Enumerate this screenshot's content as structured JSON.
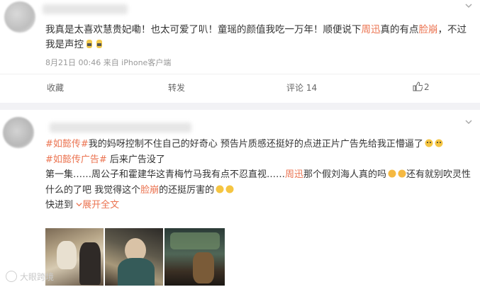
{
  "post1": {
    "text_before": "我真是太喜欢慧贵妃嘞！也太可爱了叭！童瑶的颜值我吃一万年！顺便说下",
    "highlight_name": "周迅",
    "text_mid": "真的有点",
    "highlight_word": "脸崩",
    "text_after": "，不过我是声控",
    "meta": "8月21日 00:46 来自 iPhone客户端",
    "actions": {
      "collect": "收藏",
      "share": "转发",
      "comment": "评论 14",
      "like": "2"
    }
  },
  "post2": {
    "line1_tag1": "#如懿传#",
    "line1_text": "我的妈呀控制不住自己的好奇心 预告片质感还挺好的点进正片广告先给我正懵逼了",
    "line2_tag": "#如懿传广告#",
    "line2_text": " 后来广告没了",
    "line3_a": "第一集……周公子和霍建华这青梅竹马我有点不忍直视……",
    "line3_name": "周迅",
    "line3_b": "那个假刘海人真的吗",
    "line3_c": "还有就别吹灵性什么的了吧 我觉得这个",
    "line3_word": "脸崩",
    "line3_d": "的还挺厉害的",
    "line4_a": "快进到 ",
    "expand": "展开全文",
    "expand_icon": "chevron-down-icon"
  },
  "watermark": "大眼跨境",
  "colors": {
    "accent": "#eb7350",
    "meta": "#999999"
  }
}
